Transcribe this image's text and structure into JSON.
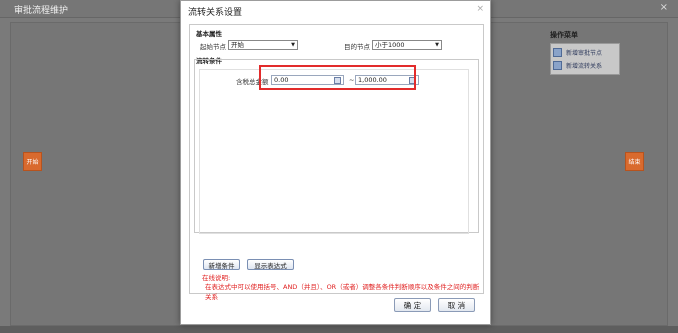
{
  "background": {
    "window_title": "审批流程维护",
    "start_node": "开始",
    "end_node": "结束",
    "ops_menu": {
      "title": "操作菜单",
      "items": [
        "新增审批节点",
        "新增流转关系"
      ]
    }
  },
  "modal": {
    "title": "流转关系设置",
    "basic_section_title": "基本属性",
    "start_node_label": "起始节点",
    "start_node_value": "开始",
    "target_node_label": "目的节点",
    "target_node_value": "小于1000",
    "condition_section_title": "流转条件",
    "amount_label": "含税总金额",
    "amount_from": "0.00",
    "amount_tilde": "~",
    "amount_to": "1,000.00",
    "add_condition_label": "新增条件",
    "show_expression_label": "显示表达式",
    "help_title": "在线说明:",
    "help_text": "在表达式中可以使用括号、AND（并且）、OR（或者）调整各条件判断顺序以及条件之间的判断关系",
    "ok_label": "确 定",
    "cancel_label": "取 消"
  }
}
